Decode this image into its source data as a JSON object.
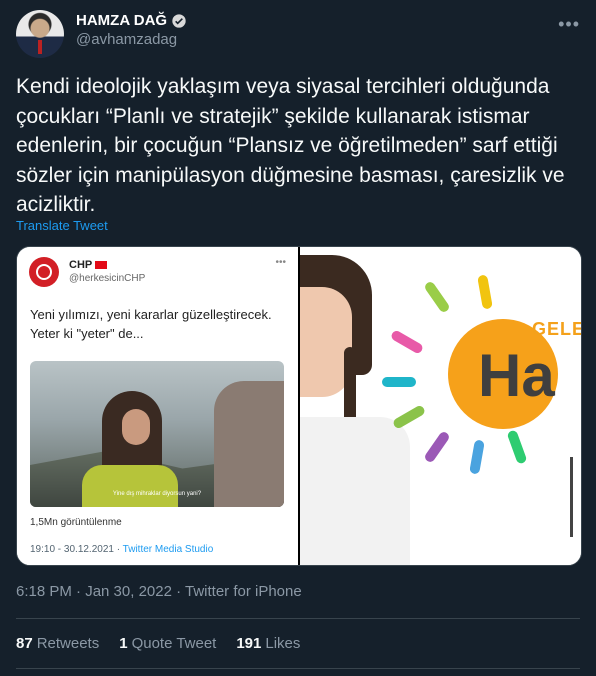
{
  "user": {
    "display_name": "HAMZA DAĞ",
    "handle": "@avhamzadag"
  },
  "icons": {
    "verified": "verified-badge-icon",
    "more": "more-options-icon"
  },
  "tweet": {
    "text": "Kendi ideolojik yaklaşım veya siyasal tercihleri olduğunda çocukları “Planlı ve stratejik” şekilde kullanarak istismar edenlerin, bir çocuğun “Plansız ve öğretilmeden” sarf ettiği sözler için  manipülasyon düğmesine basması, çaresizlik ve acizliktir.",
    "translate_label": "Translate Tweet",
    "timestamp": "6:18 PM · Jan 30, 2022 · Twitter for iPhone"
  },
  "embedded": {
    "name": "CHP",
    "handle": "@herkesicinCHP",
    "text": "Yeni yılımızı, yeni kararlar güzelleştirecek. Yeter ki \"yeter\" de...",
    "subtitle": "Yine dış mihraklar diyorsun yani?",
    "views": "1,5Mn görüntülenme",
    "time": "19:10 - 30.12.2021 · ",
    "source": "Twitter Media Studio"
  },
  "right_image": {
    "logo_text_1": "GELE",
    "logo_text_2": "Ha"
  },
  "stats": {
    "retweets_count": "87",
    "retweets_label": "Retweets",
    "quotes_count": "1",
    "quotes_label": "Quote Tweet",
    "likes_count": "191",
    "likes_label": "Likes"
  },
  "colors": {
    "background": "#15202b",
    "accent": "#1d9bf0",
    "muted": "#8b98a5"
  }
}
